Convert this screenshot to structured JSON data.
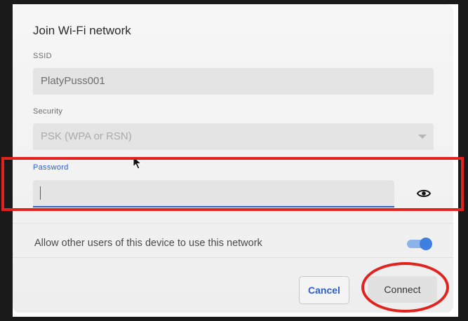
{
  "dialog": {
    "title": "Join Wi-Fi network",
    "ssid": {
      "label": "SSID",
      "value": "PlatyPuss001"
    },
    "security": {
      "label": "Security",
      "value": "PSK (WPA or RSN)"
    },
    "password": {
      "label": "Password",
      "value": ""
    },
    "allow_others": {
      "label": "Allow other users of this device to use this network",
      "enabled": true
    },
    "buttons": {
      "cancel": "Cancel",
      "connect": "Connect"
    }
  },
  "icons": {
    "password_toggle": "eye-icon",
    "security_dropdown": "chevron-down-icon",
    "cursor": "mouse-pointer-icon"
  },
  "colors": {
    "accent": "#2f5fc4",
    "toggle_on": "#3f7fe0",
    "annotation": "#e0231f"
  }
}
